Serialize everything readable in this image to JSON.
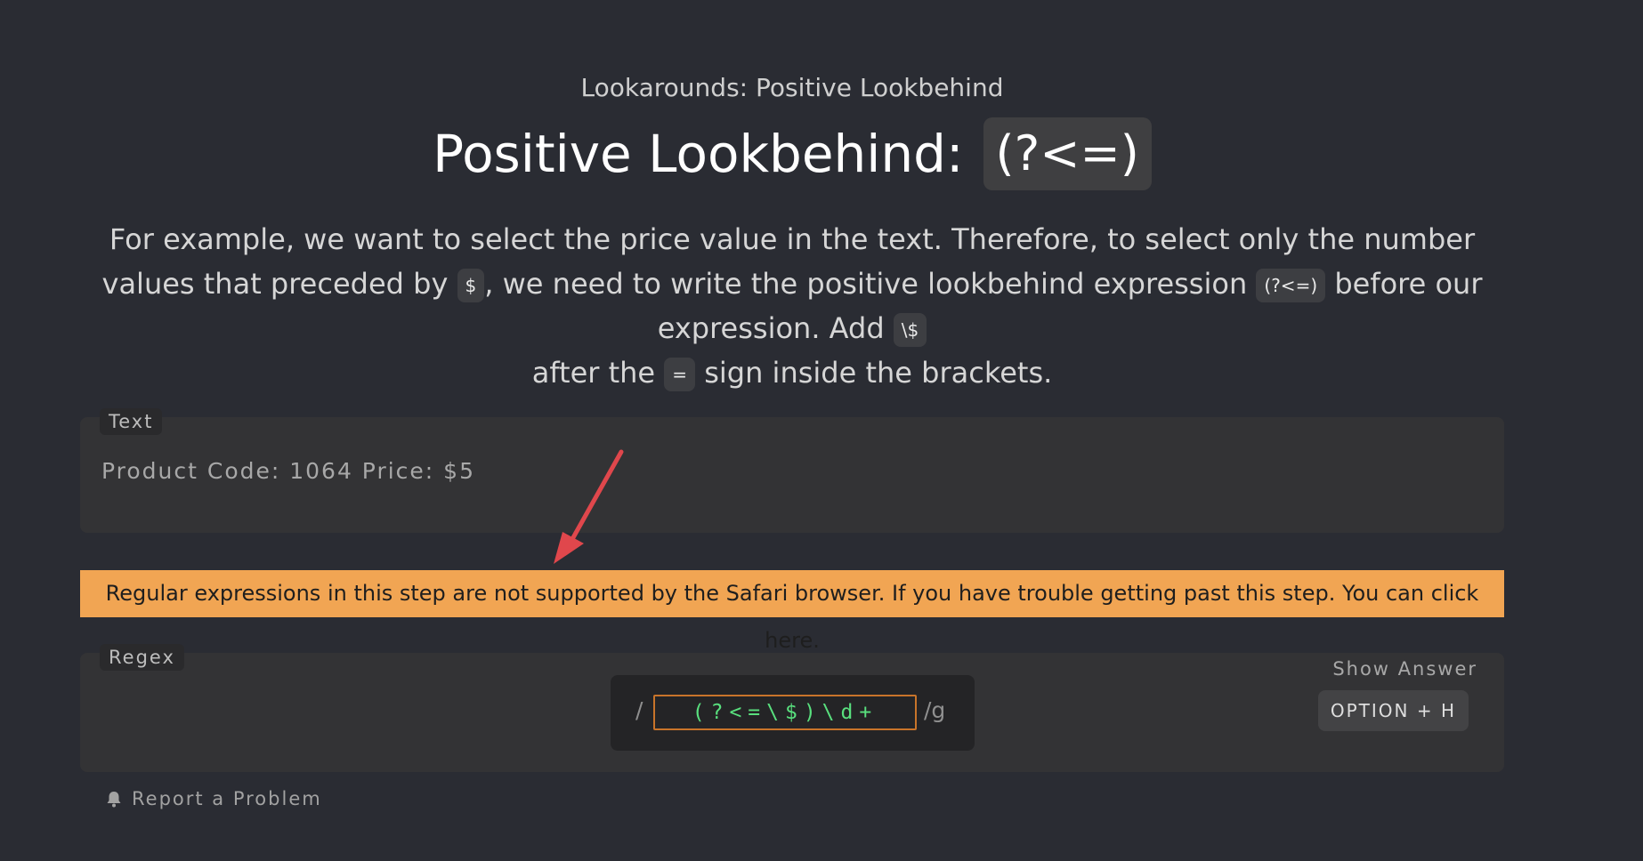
{
  "lesson": {
    "subtitle": "Lookarounds: Positive Lookbehind",
    "title": "Positive Lookbehind:",
    "title_code": "(?<=)"
  },
  "description": {
    "part1": "For example, we want to select the price value in the text. Therefore, to select only the number values that preceded by ",
    "code1": "$",
    "part2": ", we need to write the positive lookbehind expression ",
    "code2": "(?<=)",
    "part3": " before our expression. Add ",
    "code3": "\\$",
    "part4": " after the ",
    "code4": "=",
    "part5": " sign inside the brackets."
  },
  "text_panel": {
    "label": "Text",
    "value": "Product Code: 1064 Price: $5"
  },
  "warning": {
    "message": "Regular expressions in this step are not supported by the Safari browser. If you have trouble getting past this step. You can click here.",
    "color": "#f1a553"
  },
  "regex_panel": {
    "label": "Regex",
    "prefix": "/",
    "value": "(?<=\\$)\\d+",
    "flags": "/g",
    "show_answer_label": "Show Answer",
    "shortcut_label": "OPTION + H"
  },
  "footer": {
    "report_label": "Report a Problem",
    "report_icon": "bell-icon"
  },
  "colors": {
    "background": "#2a2c33",
    "panel": "#333335",
    "regex_text": "#59e07e",
    "input_border": "#c8742a",
    "arrow": "#e0474c"
  }
}
